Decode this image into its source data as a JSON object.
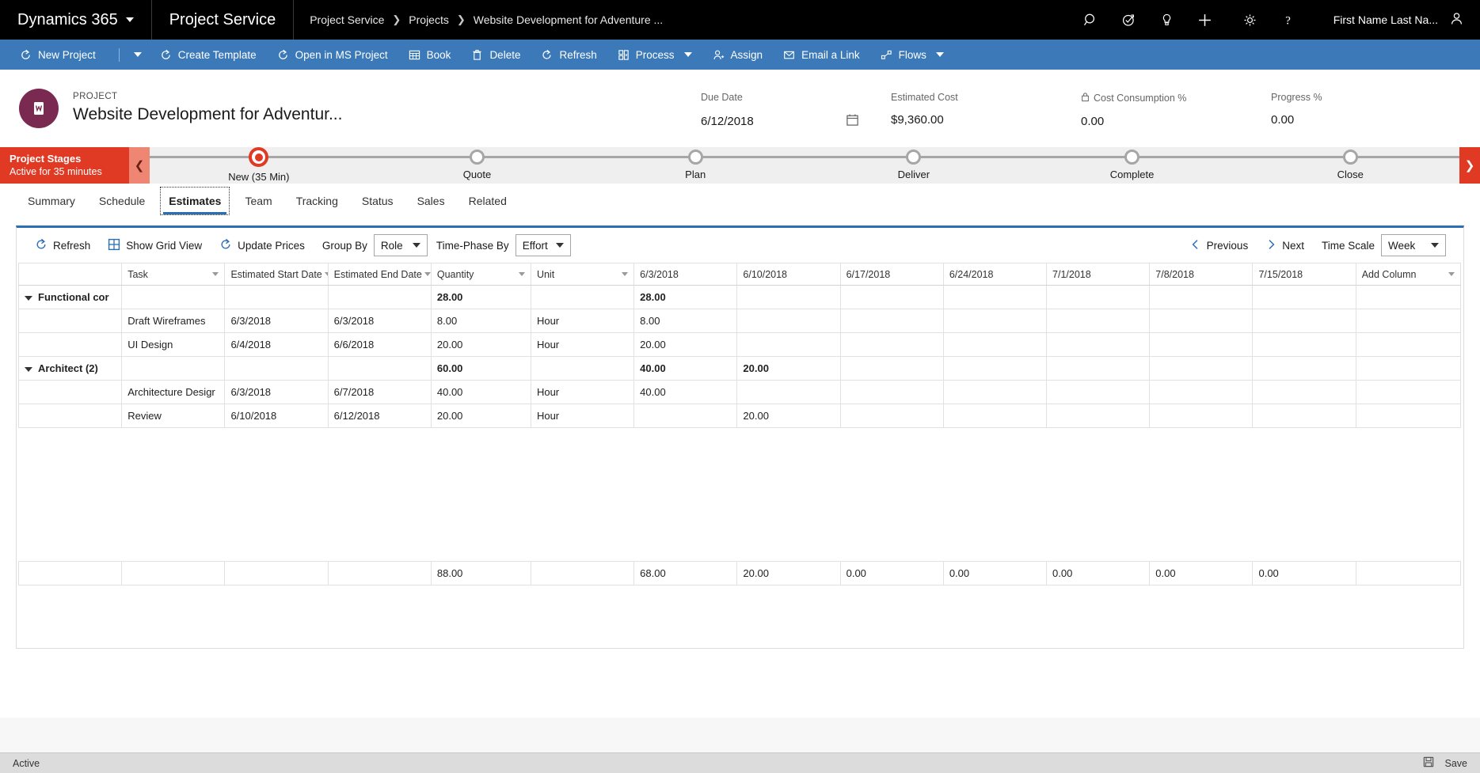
{
  "topnav": {
    "brand": "Dynamics 365",
    "app": "Project Service",
    "breadcrumb": [
      "Project Service",
      "Projects",
      "Website Development for Adventure ..."
    ],
    "icons": [
      "search-icon",
      "assistant-icon",
      "lightbulb-icon",
      "plus-icon",
      "gear-icon",
      "help-icon"
    ],
    "user": "First Name Last Na..."
  },
  "commandbar": {
    "items": [
      {
        "label": "New Project",
        "icon": "refresh-circle-icon",
        "caret": true
      },
      {
        "label": "Create Template",
        "icon": "refresh-circle-icon",
        "caret": false
      },
      {
        "label": "Open in MS Project",
        "icon": "refresh-circle-icon",
        "caret": false
      },
      {
        "label": "Book",
        "icon": "grid-icon",
        "caret": false
      },
      {
        "label": "Delete",
        "icon": "trash-icon",
        "caret": false
      },
      {
        "label": "Refresh",
        "icon": "refresh-icon",
        "caret": false
      },
      {
        "label": "Process",
        "icon": "process-icon",
        "caret": true
      },
      {
        "label": "Assign",
        "icon": "person-assign-icon",
        "caret": false
      },
      {
        "label": "Email a Link",
        "icon": "email-icon",
        "caret": false
      },
      {
        "label": "Flows",
        "icon": "flow-icon",
        "caret": true
      }
    ]
  },
  "project": {
    "kicker": "PROJECT",
    "name": "Website Development for Adventur...",
    "fields": [
      {
        "label": "Due Date",
        "value": "6/12/2018",
        "icon": "calendar-icon",
        "lock": false
      },
      {
        "label": "Estimated Cost",
        "value": "$9,360.00",
        "icon": "",
        "lock": false
      },
      {
        "label": "Cost Consumption %",
        "value": "0.00",
        "icon": "",
        "lock": true
      },
      {
        "label": "Progress %",
        "value": "0.00",
        "icon": "",
        "lock": false
      }
    ]
  },
  "bpf": {
    "title": "Project Stages",
    "subtitle": "Active for 35 minutes",
    "stages": [
      {
        "label": "New  (35 Min)",
        "active": true
      },
      {
        "label": "Quote",
        "active": false
      },
      {
        "label": "Plan",
        "active": false
      },
      {
        "label": "Deliver",
        "active": false
      },
      {
        "label": "Complete",
        "active": false
      },
      {
        "label": "Close",
        "active": false
      }
    ],
    "accent": "#e03a24"
  },
  "tabs": [
    {
      "label": "Summary",
      "active": false
    },
    {
      "label": "Schedule",
      "active": false
    },
    {
      "label": "Estimates",
      "active": true
    },
    {
      "label": "Team",
      "active": false
    },
    {
      "label": "Tracking",
      "active": false
    },
    {
      "label": "Status",
      "active": false
    },
    {
      "label": "Sales",
      "active": false
    },
    {
      "label": "Related",
      "active": false
    }
  ],
  "gridbar": {
    "refresh": "Refresh",
    "show_grid_view": "Show Grid View",
    "update_prices": "Update Prices",
    "group_by_label": "Group By",
    "group_by_value": "Role",
    "time_phase_label": "Time-Phase By",
    "time_phase_value": "Effort",
    "previous": "Previous",
    "next": "Next",
    "time_scale_label": "Time Scale",
    "time_scale_value": "Week"
  },
  "grid": {
    "columns": [
      {
        "label": "",
        "caret": false,
        "align": "left"
      },
      {
        "label": "Task",
        "caret": true,
        "align": "left"
      },
      {
        "label": "Estimated Start Date",
        "caret": true,
        "align": "left"
      },
      {
        "label": "Estimated End Date",
        "caret": true,
        "align": "left"
      },
      {
        "label": "Quantity",
        "caret": true,
        "align": "right"
      },
      {
        "label": "Unit",
        "caret": true,
        "align": "left"
      },
      {
        "label": "6/3/2018",
        "caret": false,
        "align": "right"
      },
      {
        "label": "6/10/2018",
        "caret": false,
        "align": "right"
      },
      {
        "label": "6/17/2018",
        "caret": false,
        "align": "right"
      },
      {
        "label": "6/24/2018",
        "caret": false,
        "align": "right"
      },
      {
        "label": "7/1/2018",
        "caret": false,
        "align": "right"
      },
      {
        "label": "7/8/2018",
        "caret": false,
        "align": "right"
      },
      {
        "label": "7/15/2018",
        "caret": false,
        "align": "right"
      },
      {
        "label": "Add Column",
        "caret": true,
        "align": "left"
      }
    ],
    "rows": [
      {
        "type": "group",
        "group": "Functional cor",
        "task": "",
        "start": "",
        "end": "",
        "qty": "28.00",
        "unit": "",
        "p": [
          "28.00",
          "",
          "",
          "",
          "",
          "",
          ""
        ]
      },
      {
        "type": "task",
        "group": "",
        "task": "Draft Wireframes",
        "start": "6/3/2018",
        "end": "6/3/2018",
        "qty": "8.00",
        "unit": "Hour",
        "p": [
          "8.00",
          "",
          "",
          "",
          "",
          "",
          ""
        ]
      },
      {
        "type": "task",
        "group": "",
        "task": "UI Design",
        "start": "6/4/2018",
        "end": "6/6/2018",
        "qty": "20.00",
        "unit": "Hour",
        "p": [
          "20.00",
          "",
          "",
          "",
          "",
          "",
          ""
        ]
      },
      {
        "type": "group",
        "group": "Architect (2)",
        "task": "",
        "start": "",
        "end": "",
        "qty": "60.00",
        "unit": "",
        "p": [
          "40.00",
          "20.00",
          "",
          "",
          "",
          "",
          ""
        ]
      },
      {
        "type": "task",
        "group": "",
        "task": "Architecture Desigr",
        "start": "6/3/2018",
        "end": "6/7/2018",
        "qty": "40.00",
        "unit": "Hour",
        "p": [
          "40.00",
          "",
          "",
          "",
          "",
          "",
          ""
        ]
      },
      {
        "type": "task",
        "group": "",
        "task": "Review",
        "start": "6/10/2018",
        "end": "6/12/2018",
        "qty": "20.00",
        "unit": "Hour",
        "p": [
          "",
          "20.00",
          "",
          "",
          "",
          "",
          ""
        ]
      }
    ],
    "totals": {
      "blank1": "",
      "blank2": "",
      "blank3": "",
      "blank4": "",
      "qty": "88.00",
      "unit": "",
      "p": [
        "68.00",
        "20.00",
        "0.00",
        "0.00",
        "0.00",
        "0.00",
        "0.00"
      ],
      "last": ""
    }
  },
  "statusbar": {
    "status": "Active",
    "save": "Save",
    "save_icon": "save-icon"
  }
}
